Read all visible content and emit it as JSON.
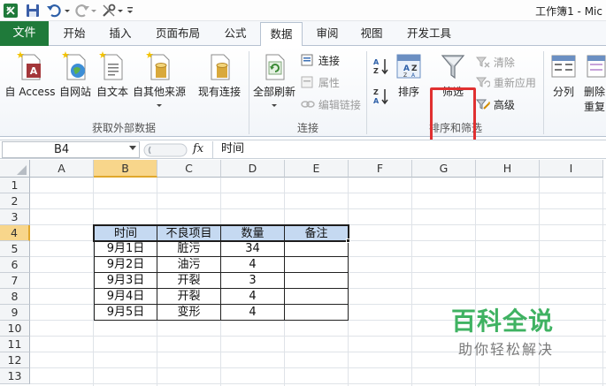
{
  "window": {
    "title": "工作簿1 - Mic"
  },
  "tabs": [
    {
      "label": "文件"
    },
    {
      "label": "开始"
    },
    {
      "label": "插入"
    },
    {
      "label": "页面布局"
    },
    {
      "label": "公式"
    },
    {
      "label": "数据",
      "active": true
    },
    {
      "label": "审阅"
    },
    {
      "label": "视图"
    },
    {
      "label": "开发工具"
    }
  ],
  "ribbon": {
    "get_external": {
      "group_label": "获取外部数据",
      "access": "自 Access",
      "web": "自网站",
      "text": "自文本",
      "other": "自其他来源",
      "existing": "现有连接"
    },
    "connections": {
      "group_label": "连接",
      "refresh_all": "全部刷新",
      "connections": "连接",
      "properties": "属性",
      "edit_links": "编辑链接"
    },
    "sort_filter": {
      "group_label": "排序和筛选",
      "sort": "排序",
      "filter": "筛选",
      "clear": "清除",
      "reapply": "重新应用",
      "advanced": "高级"
    },
    "data_tools": {
      "text_to_columns": "分列",
      "remove_dup_line1": "删除",
      "remove_dup_line2": "重复"
    }
  },
  "formula_bar": {
    "name_box": "B4",
    "fx": "fx",
    "content": "时间"
  },
  "columns": [
    "A",
    "B",
    "C",
    "D",
    "E",
    "F",
    "G",
    "H",
    "I"
  ],
  "rows": [
    "1",
    "2",
    "3",
    "4",
    "5",
    "6",
    "7",
    "8",
    "9",
    "10",
    "11",
    "12",
    "13"
  ],
  "table": {
    "headers": [
      "时间",
      "不良项目",
      "数量",
      "备注"
    ],
    "rows": [
      [
        "9月1日",
        "脏污",
        "34",
        ""
      ],
      [
        "9月2日",
        "油污",
        "4",
        ""
      ],
      [
        "9月3日",
        "开裂",
        "3",
        ""
      ],
      [
        "9月4日",
        "开裂",
        "4",
        ""
      ],
      [
        "9月5日",
        "变形",
        "4",
        ""
      ]
    ]
  },
  "watermark": {
    "title": "百科全说",
    "subtitle": "助你轻松解决"
  },
  "colors": {
    "file_tab": "#1f7a3a",
    "header_fill": "#c5d9f1",
    "highlight": "#e03030",
    "watermark": "#3fb262"
  }
}
